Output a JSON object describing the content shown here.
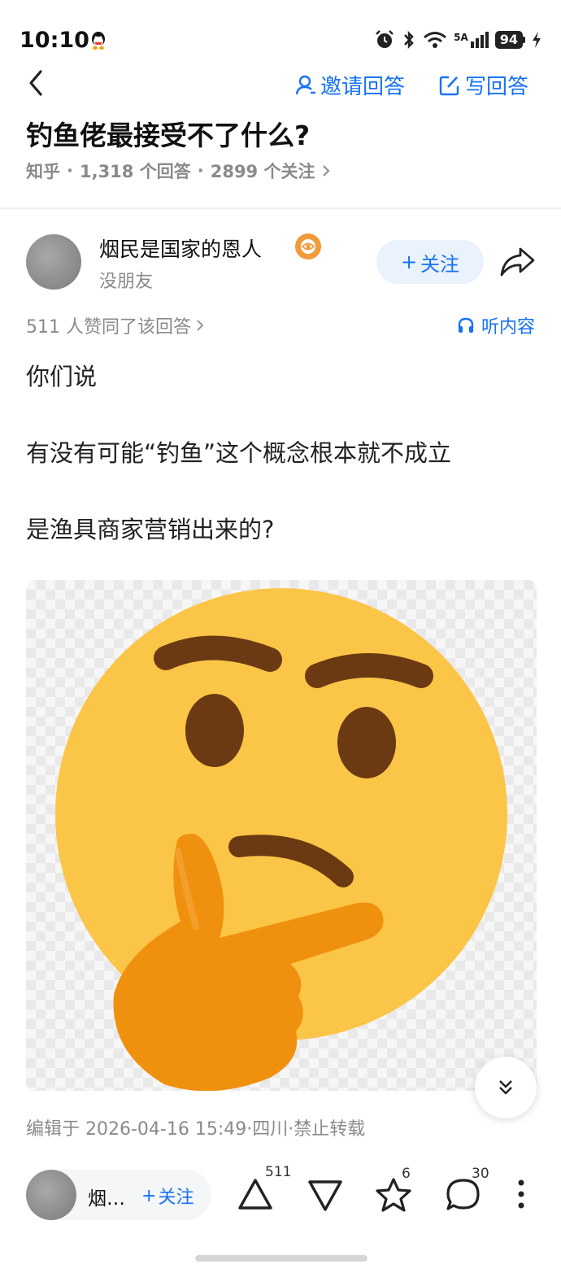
{
  "status_bar": {
    "time": "10:10",
    "network": "5A",
    "battery": "94"
  },
  "header": {
    "invite_label": "邀请回答",
    "write_label": "写回答"
  },
  "question": {
    "title": "钓鱼佬最接受不了什么?",
    "source": "知乎",
    "answers": "1,318 个回答",
    "followers": "2899 个关注"
  },
  "author": {
    "name": "烟民是国家的恩人",
    "subtitle": "没朋友",
    "follow_label": "关注"
  },
  "answer": {
    "upvote_text": "511 人赞同了该回答",
    "listen_label": "听内容",
    "paragraphs": [
      "你们说",
      "有没有可能“钓鱼”这个概念根本就不成立",
      "是渔具商家营销出来的?"
    ],
    "edit_info": "编辑于 2026-04-16 15:49·四川·禁止转载"
  },
  "bottom_bar": {
    "author_short": "烟…",
    "follow_label": "关注",
    "upvote_count": "511",
    "collect_count": "6",
    "comment_count": "30"
  },
  "colors": {
    "accent": "#1772f6",
    "muted": "#8a8a8a",
    "follow_bg": "#eaf2fe",
    "emoji_face": "#fbc547",
    "emoji_hand": "#f0900f"
  }
}
